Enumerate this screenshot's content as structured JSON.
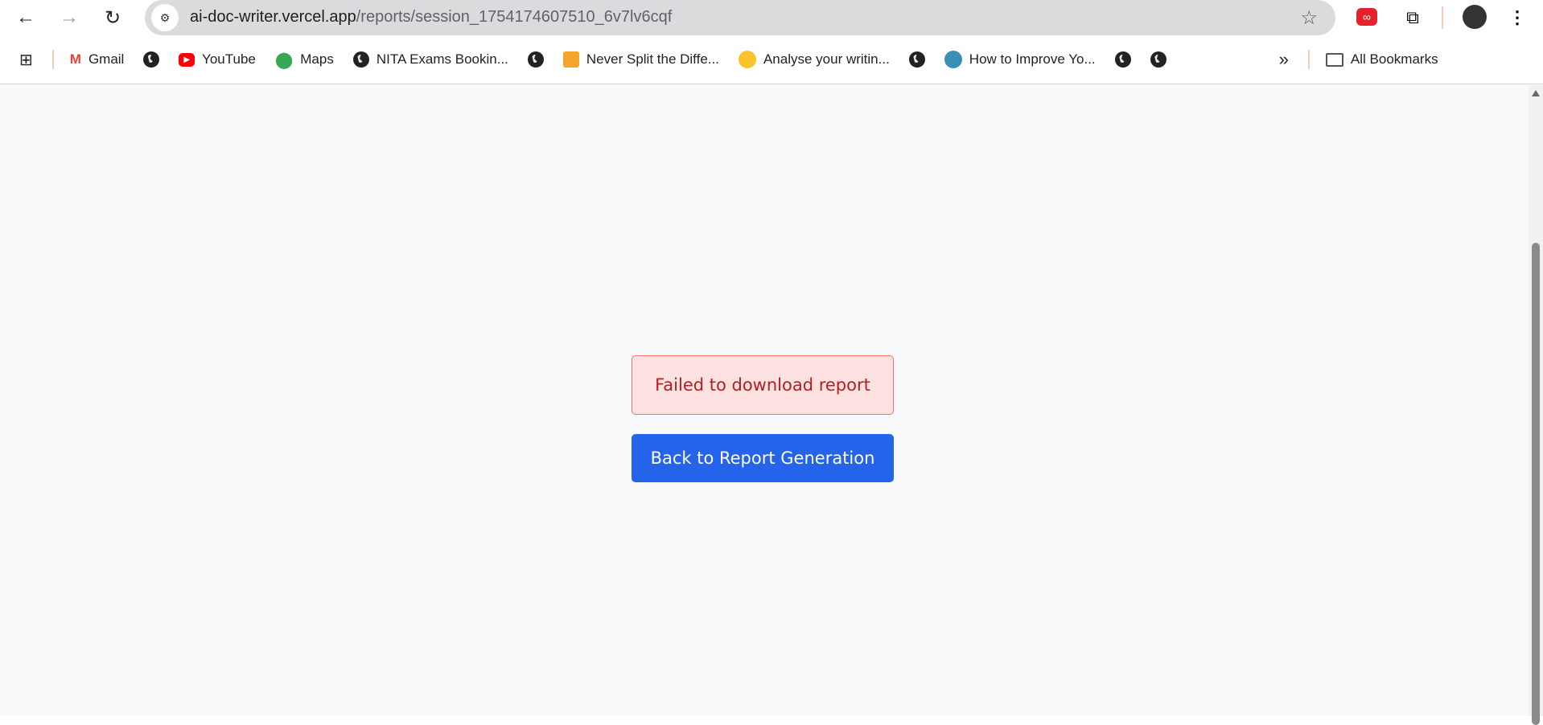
{
  "browser": {
    "url_host": "ai-doc-writer.vercel.app",
    "url_path": "/reports/session_1754174607510_6v7lv6cqf",
    "bookmarks": [
      "Gmail",
      "YouTube",
      "Maps",
      "NITA Exams Bookin...",
      "Never Split the Diffe...",
      "Analyse your writin...",
      "How to Improve Yo..."
    ],
    "all_bookmarks": "All Bookmarks",
    "overflow": "»"
  },
  "main": {
    "error_message": "Failed to download report",
    "back_button": "Back to Report Generation"
  },
  "colors": {
    "accent": "#2563eb",
    "error_bg": "#fee2e2",
    "error_text": "#b91c1c"
  }
}
